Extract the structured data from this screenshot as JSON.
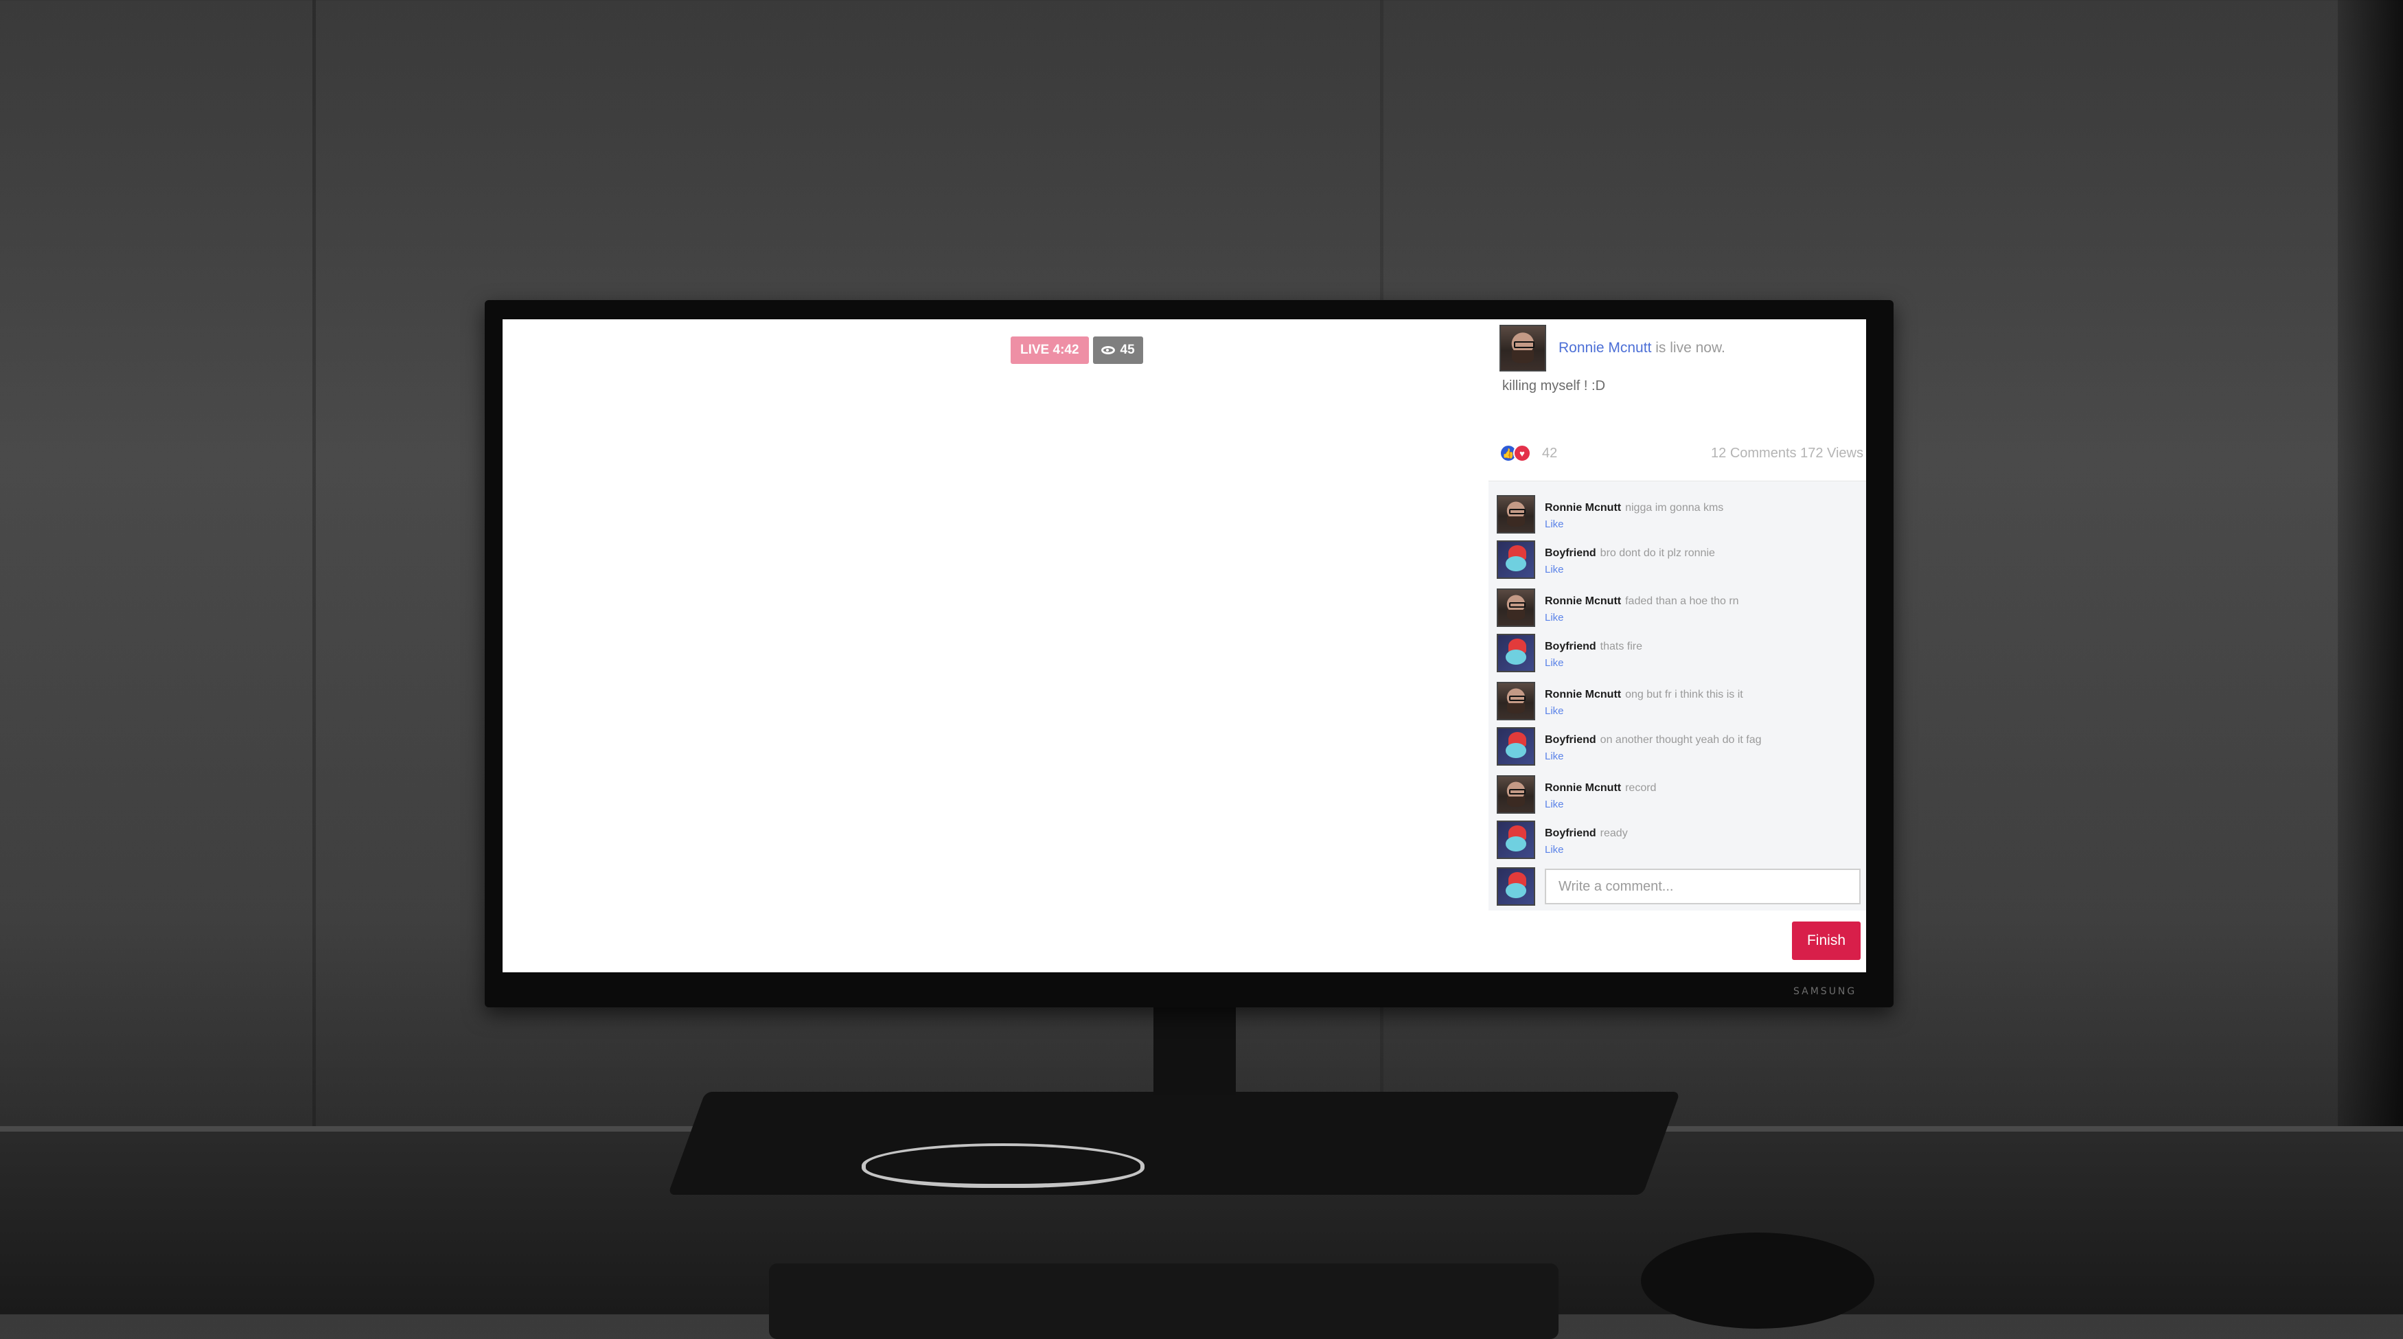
{
  "stream": {
    "live_label": "LIVE 4:42",
    "viewer_count": "45"
  },
  "host": {
    "name": "Ronnie Mcnutt",
    "status": "is live now."
  },
  "post": {
    "caption": "killing myself ! :D"
  },
  "stats": {
    "reaction_count": "42",
    "comments_views": "12 Comments 172 Views"
  },
  "comments": [
    {
      "author": "Ronnie Mcnutt",
      "text": "nigga im gonna kms",
      "like": "Like"
    },
    {
      "author": "Boyfriend",
      "text": "bro dont do it plz ronnie",
      "like": "Like"
    },
    {
      "author": "Ronnie Mcnutt",
      "text": "faded than a hoe tho rn",
      "like": "Like"
    },
    {
      "author": "Boyfriend",
      "text": "thats fire",
      "like": "Like"
    },
    {
      "author": "Ronnie Mcnutt",
      "text": "ong but fr i think this is it",
      "like": "Like"
    },
    {
      "author": "Boyfriend",
      "text": "on another thought yeah do it fag",
      "like": "Like"
    },
    {
      "author": "Ronnie Mcnutt",
      "text": "record",
      "like": "Like"
    },
    {
      "author": "Boyfriend",
      "text": "ready",
      "like": "Like"
    }
  ],
  "compose": {
    "placeholder": "Write a comment..."
  },
  "actions": {
    "finish_label": "Finish"
  },
  "device": {
    "brand": "SAMSUNG"
  }
}
